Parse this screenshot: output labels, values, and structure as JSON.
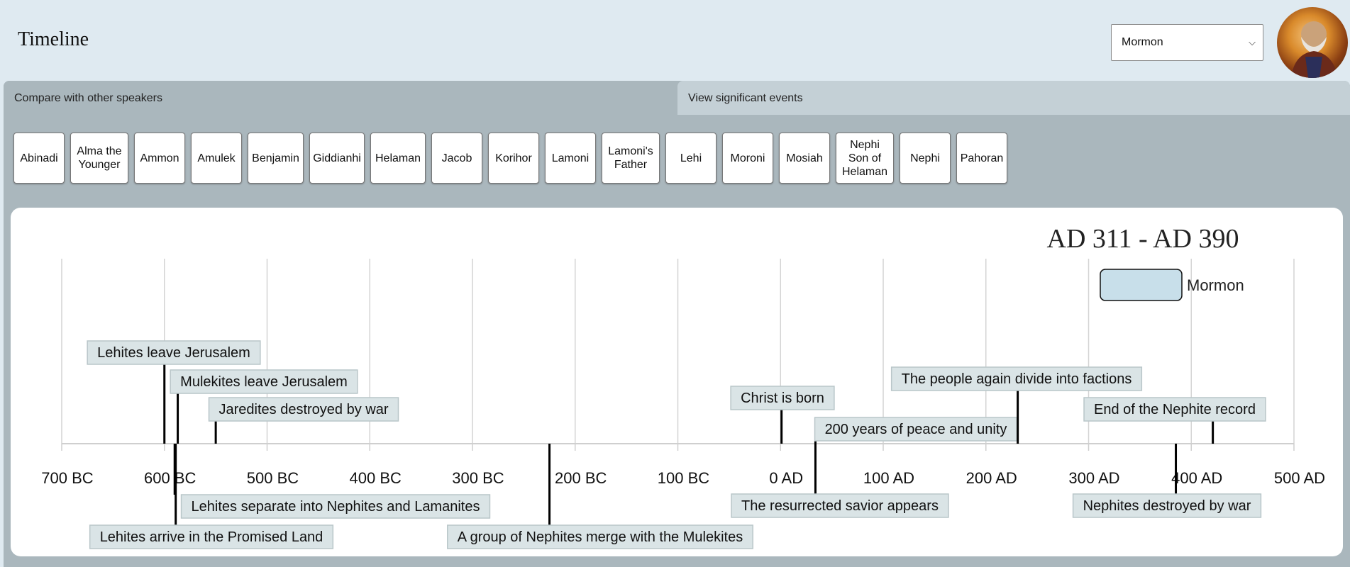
{
  "header": {
    "title": "Timeline",
    "speaker_select": "Mormon"
  },
  "tabs": [
    {
      "label": "Compare with other speakers"
    },
    {
      "label": "View significant events"
    }
  ],
  "speakers": [
    {
      "label": "Abinadi"
    },
    {
      "label": "Alma the Younger"
    },
    {
      "label": "Ammon"
    },
    {
      "label": "Amulek"
    },
    {
      "label": "Benjamin"
    },
    {
      "label": "Giddianhi"
    },
    {
      "label": "Helaman"
    },
    {
      "label": "Jacob"
    },
    {
      "label": "Korihor"
    },
    {
      "label": "Lamoni"
    },
    {
      "label": "Lamoni's Father"
    },
    {
      "label": "Lehi"
    },
    {
      "label": "Moroni"
    },
    {
      "label": "Mosiah"
    },
    {
      "label": "Nephi Son of Helaman"
    },
    {
      "label": "Nephi"
    },
    {
      "label": "Pahoran"
    }
  ],
  "timeline": {
    "range_label": "AD 311 - AD 390",
    "legend": {
      "label": "Mormon",
      "color": "#c8dfea"
    },
    "ticks": [
      "700 BC",
      "600 BC",
      "500 BC",
      "400 BC",
      "300 BC",
      "200 BC",
      "100 BC",
      "0 AD",
      "100 AD",
      "200 AD",
      "300 AD",
      "400 AD",
      "500 AD"
    ],
    "tick_years": [
      -700,
      -600,
      -500,
      -400,
      -300,
      -200,
      -100,
      0,
      100,
      200,
      300,
      400,
      500
    ],
    "events_above": [
      {
        "label": "Lehites leave Jerusalem",
        "year": -600
      },
      {
        "label": "Mulekites leave Jerusalem",
        "year": -587
      },
      {
        "label": "Jaredites destroyed by war",
        "year": -550
      },
      {
        "label": "Christ is born",
        "year": 1
      },
      {
        "label": "200 years of peace and unity",
        "year": 34
      },
      {
        "label": "The people again divide into factions",
        "year": 231
      },
      {
        "label": "End of the Nephite record",
        "year": 421
      }
    ],
    "events_below": [
      {
        "label": "Lehites separate into Nephites and Lamanites",
        "year": -590
      },
      {
        "label": "Lehites arrive in the Promised Land",
        "year": -589
      },
      {
        "label": "A group of Nephites merge with the Mulekites",
        "year": -225
      },
      {
        "label": "The resurrected savior appears",
        "year": 34
      },
      {
        "label": "Nephites destroyed by war",
        "year": 385
      }
    ]
  }
}
